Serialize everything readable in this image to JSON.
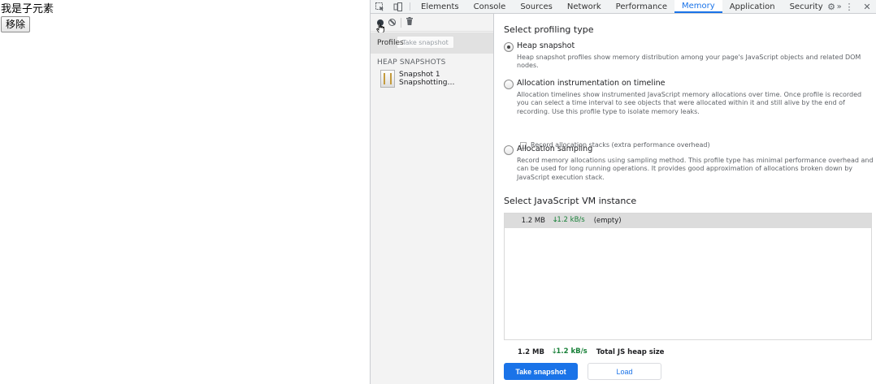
{
  "page": {
    "text": "我是子元素",
    "remove_label": "移除"
  },
  "devtools": {
    "tabs": [
      {
        "label": "Elements"
      },
      {
        "label": "Console"
      },
      {
        "label": "Sources"
      },
      {
        "label": "Network"
      },
      {
        "label": "Performance"
      },
      {
        "label": "Memory"
      },
      {
        "label": "Application"
      },
      {
        "label": "Security"
      }
    ],
    "more_tabs": "»",
    "active_tab": "Memory",
    "sidebar": {
      "profiles_label": "Profiles",
      "take_snapshot_ghost": "Take snapshot",
      "heap_header": "HEAP SNAPSHOTS",
      "snapshot_name": "Snapshot 1",
      "snapshot_status": "Snapshotting…"
    },
    "main": {
      "select_profiling_type": "Select profiling type",
      "options": [
        {
          "title": "Heap snapshot",
          "desc": "Heap snapshot profiles show memory distribution among your page's JavaScript objects and related DOM nodes."
        },
        {
          "title": "Allocation instrumentation on timeline",
          "desc": "Allocation timelines show instrumented JavaScript memory allocations over time. Once profile is recorded you can select a time interval to see objects that were allocated within it and still alive by the end of recording. Use this profile type to isolate memory leaks."
        },
        {
          "title": "Allocation sampling",
          "desc": "Record memory allocations using sampling method. This profile type has minimal performance overhead and can be used for long running operations. It provides good approximation of allocations broken down by JavaScript execution stack."
        }
      ],
      "record_stacks_label": "Record allocation stacks (extra performance overhead)",
      "select_vm": "Select JavaScript VM instance",
      "vm_rows": [
        {
          "size": "1.2 MB",
          "rate": "1.2 kB/s",
          "name": "(empty)"
        }
      ],
      "summary": {
        "size": "1.2 MB",
        "rate": "1.2 kB/s",
        "label": "Total JS heap size"
      },
      "take_snapshot": "Take snapshot",
      "load": "Load"
    }
  }
}
